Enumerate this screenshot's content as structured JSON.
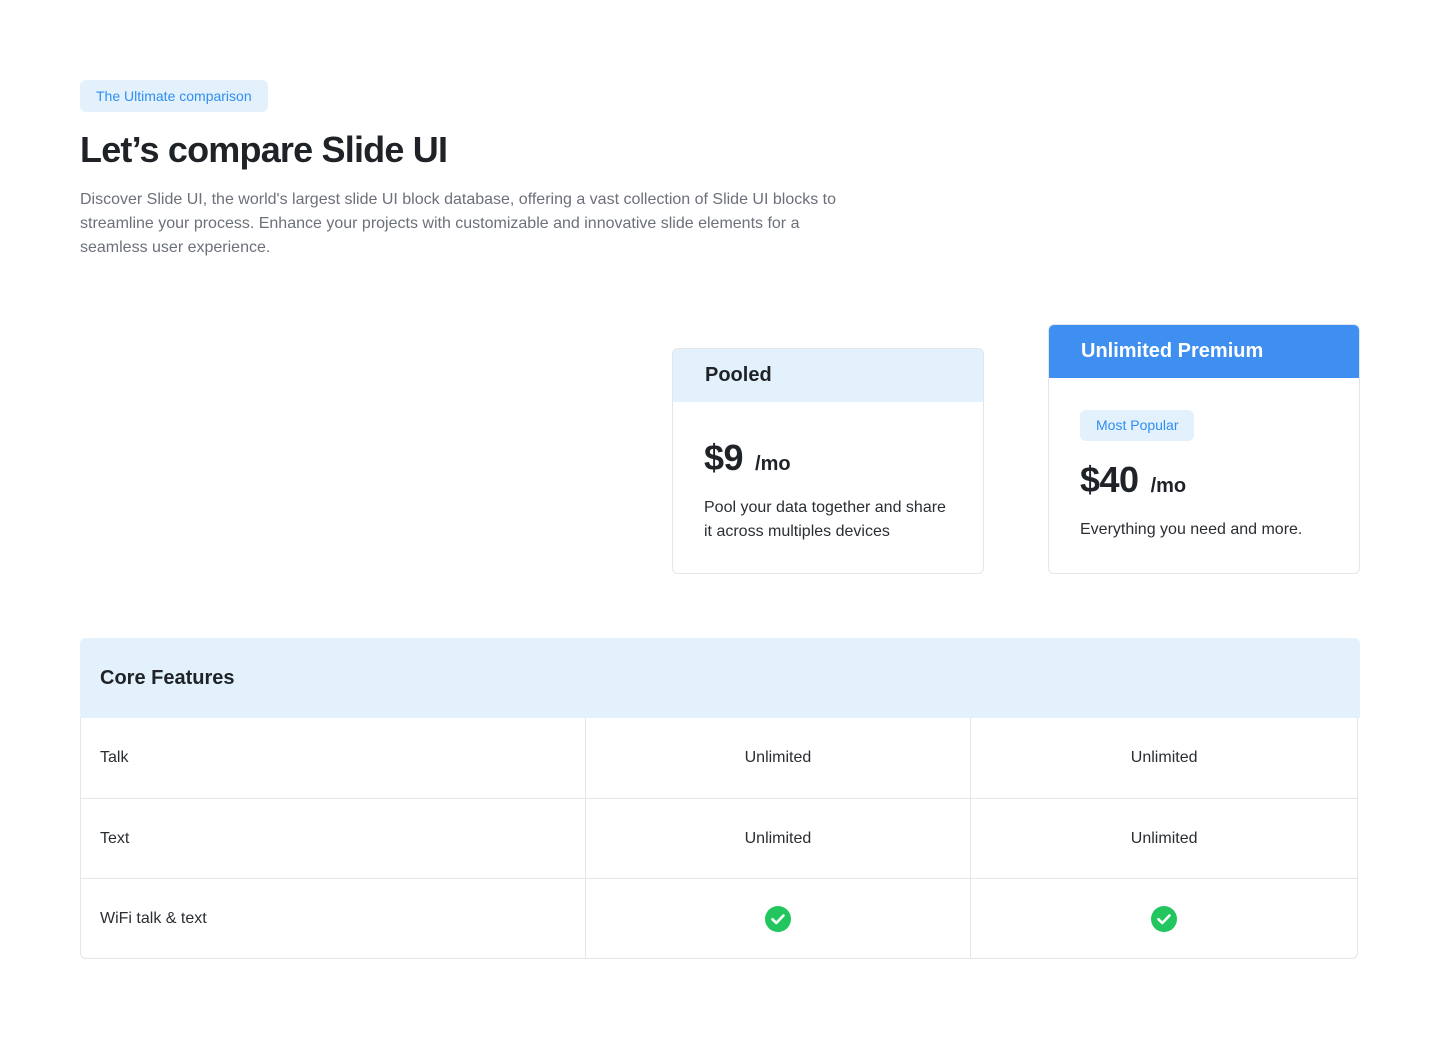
{
  "hero": {
    "eyebrow": "The Ultimate comparison",
    "title": "Let’s compare Slide UI",
    "description": "Discover Slide UI, the world's largest slide UI block database, offering a vast collection of Slide UI blocks to streamline your process. Enhance your projects with customizable and innovative slide elements for a seamless user experience."
  },
  "plans": [
    {
      "name": "Pooled",
      "price": "$9",
      "period": "/mo",
      "description": "Pool your data together and share it across multiples devices"
    },
    {
      "name": "Unlimited Premium",
      "badge": "Most Popular",
      "price": "$40",
      "period": "/mo",
      "description": "Everything you need and more."
    }
  ],
  "features": {
    "title": "Core Features",
    "rows": [
      {
        "name": "Talk",
        "pooled": "Unlimited",
        "premium": "Unlimited"
      },
      {
        "name": "Text",
        "pooled": "Unlimited",
        "premium": "Unlimited"
      },
      {
        "name": "WiFi talk & text",
        "pooled_icon": "check-circle-icon",
        "premium_icon": "check-circle-icon"
      }
    ]
  },
  "colors": {
    "accent": "#3e8ff0",
    "accent_light": "#e3f1fd",
    "check": "#22c55e"
  }
}
